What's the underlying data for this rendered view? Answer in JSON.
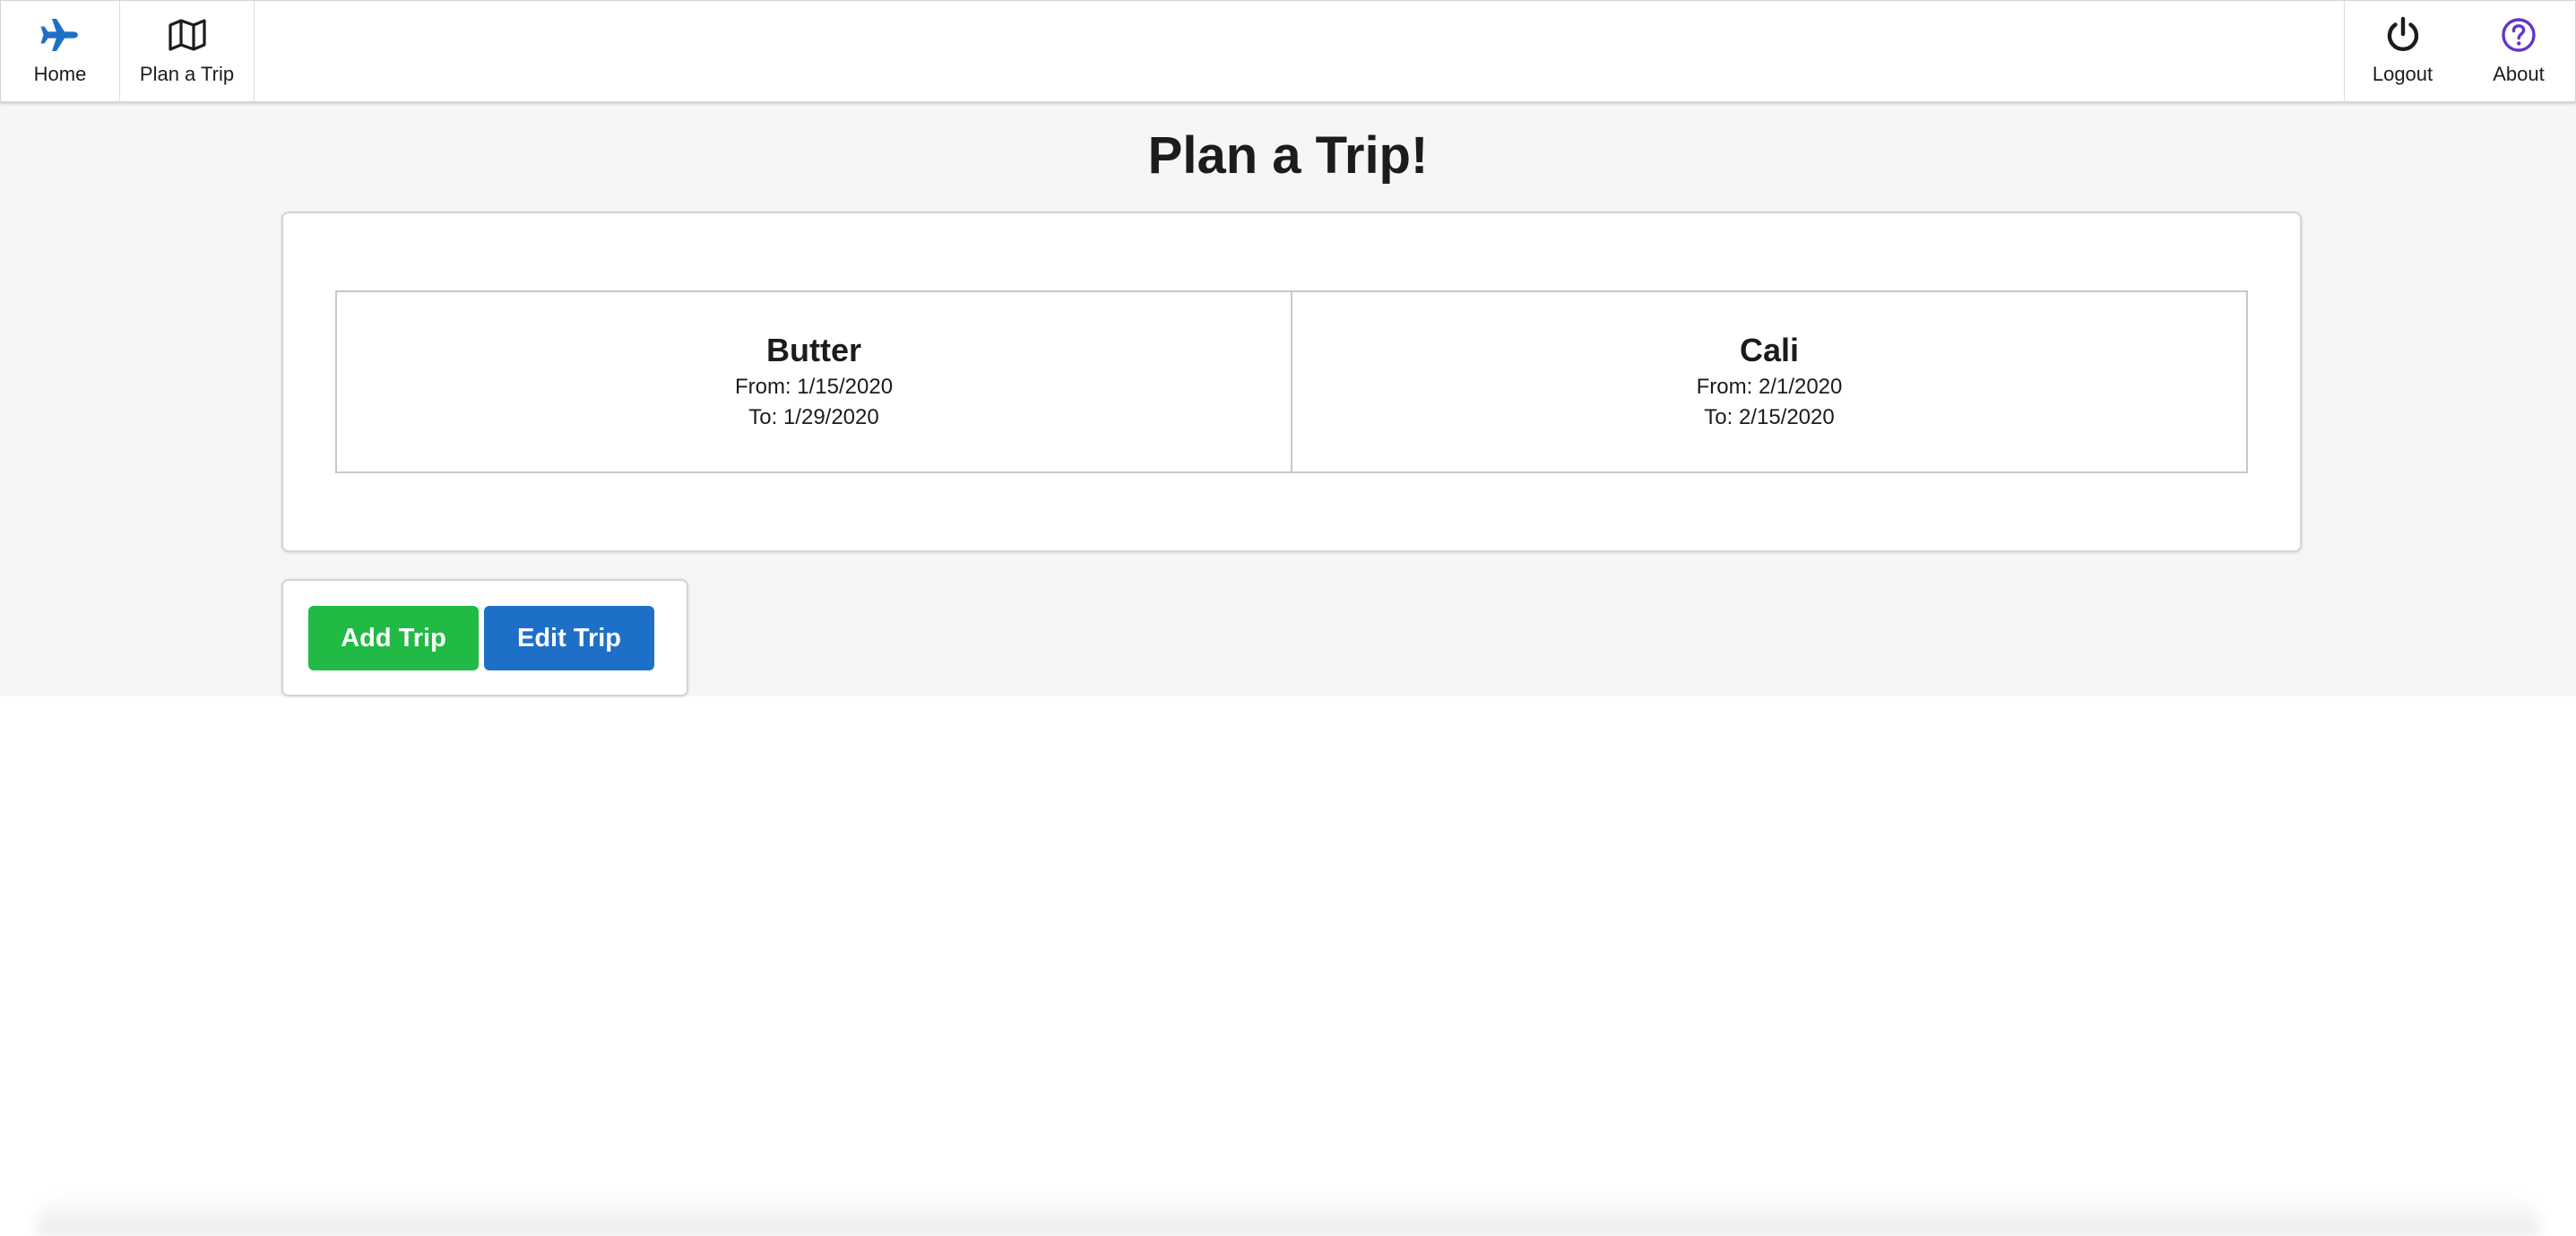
{
  "nav": {
    "home_label": "Home",
    "plan_label": "Plan a Trip",
    "logout_label": "Logout",
    "about_label": "About",
    "icons": {
      "home": "airplane-icon",
      "plan": "map-icon",
      "logout": "power-icon",
      "about": "question-circle-icon"
    }
  },
  "page": {
    "title": "Plan a Trip!"
  },
  "trips": [
    {
      "name": "Butter",
      "from": "From: 1/15/2020",
      "to": "To: 1/29/2020"
    },
    {
      "name": "Cali",
      "from": "From: 2/1/2020",
      "to": "To: 2/15/2020"
    }
  ],
  "actions": {
    "add_label": "Add Trip",
    "edit_label": "Edit Trip"
  },
  "colors": {
    "add_button": "#21ba45",
    "edit_button": "#1e6fc8",
    "airplane_icon": "#1e6fc8",
    "about_icon": "#6435c9"
  }
}
